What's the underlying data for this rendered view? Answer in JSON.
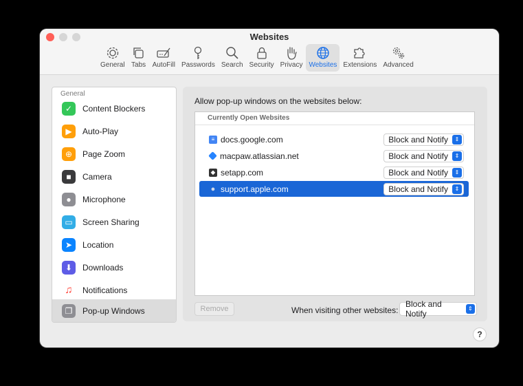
{
  "window": {
    "title": "Websites"
  },
  "toolbar": {
    "items": [
      {
        "label": "General",
        "icon": "gear-icon"
      },
      {
        "label": "Tabs",
        "icon": "tabs-icon"
      },
      {
        "label": "AutoFill",
        "icon": "pencil-form-icon"
      },
      {
        "label": "Passwords",
        "icon": "key-icon"
      },
      {
        "label": "Search",
        "icon": "magnifier-icon"
      },
      {
        "label": "Security",
        "icon": "lock-icon"
      },
      {
        "label": "Privacy",
        "icon": "hand-icon"
      },
      {
        "label": "Websites",
        "icon": "globe-icon"
      },
      {
        "label": "Extensions",
        "icon": "puzzle-icon"
      },
      {
        "label": "Advanced",
        "icon": "gears-icon"
      }
    ],
    "active": "Websites"
  },
  "sidebar": {
    "section_label": "General",
    "items": [
      {
        "label": "Content Blockers",
        "icon": "check-shield-icon",
        "color": "#34c759"
      },
      {
        "label": "Auto-Play",
        "icon": "play-icon",
        "color": "#ff9f0a"
      },
      {
        "label": "Page Zoom",
        "icon": "zoom-icon",
        "color": "#ff9f0a"
      },
      {
        "label": "Camera",
        "icon": "camera-icon",
        "color": "#3a3a3c"
      },
      {
        "label": "Microphone",
        "icon": "microphone-icon",
        "color": "#8e8e93"
      },
      {
        "label": "Screen Sharing",
        "icon": "screen-share-icon",
        "color": "#32ade6"
      },
      {
        "label": "Location",
        "icon": "location-arrow-icon",
        "color": "#0a84ff"
      },
      {
        "label": "Downloads",
        "icon": "download-icon",
        "color": "#5e5ce6"
      },
      {
        "label": "Notifications",
        "icon": "bell-icon",
        "color": "#ff3b30"
      },
      {
        "label": "Pop-up Windows",
        "icon": "popup-window-icon",
        "color": "#8e8e93"
      }
    ],
    "selected": "Pop-up Windows"
  },
  "main": {
    "allow_label": "Allow pop-up windows on the websites below:",
    "list_header": "Currently Open Websites",
    "sites": [
      {
        "name": "docs.google.com",
        "setting": "Block and Notify",
        "icon": "google-docs-icon",
        "color": "#4285f4"
      },
      {
        "name": "macpaw.atlassian.net",
        "setting": "Block and Notify",
        "icon": "atlassian-icon",
        "color": "#2684ff"
      },
      {
        "name": "setapp.com",
        "setting": "Block and Notify",
        "icon": "setapp-icon",
        "color": "#333333"
      },
      {
        "name": "support.apple.com",
        "setting": "Block and Notify",
        "icon": "apple-icon",
        "color": "#aaaaaa"
      }
    ],
    "selected_site": "support.apple.com",
    "remove_label": "Remove",
    "visiting_label": "When visiting other websites:",
    "visiting_value": "Block and Notify"
  },
  "help_label": "?",
  "accent_color": "#1a6fe8"
}
